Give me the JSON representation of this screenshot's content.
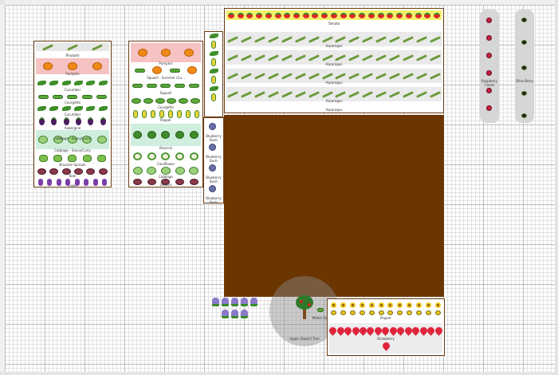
{
  "beds": {
    "bed_a": {
      "labels": [
        "Rhubarb",
        "Pumpkin",
        "Cucumber",
        "Courgette",
        "Cucumber",
        "Aubergine",
        "Cabbage - Savoy/Curly",
        "Cabbage - Savoy/Curly",
        "Brussels Sprouts",
        "Kale",
        "Leek"
      ]
    },
    "bed_b": {
      "labels": [
        "Pumpkin",
        "Squash - Summer (Cu...",
        "Squash",
        "Courgette",
        "Pepper",
        "Broccoli",
        "Cauliflower",
        "Cabbage",
        "Lettuce"
      ]
    },
    "bed_c": {
      "labels": [
        "Tomato",
        "Asparagus",
        "Asparagus",
        "Asparagus",
        "Asparagus",
        "Asparagus"
      ]
    },
    "bed_d": {
      "labels": [
        "Blueberry Bush",
        "Blueberry Bush",
        "Blueberry Bush",
        "Blueberry Bush"
      ]
    },
    "bed_e": {
      "labels": [
        "Raspberry Canes"
      ]
    },
    "bed_f": {
      "labels": [
        "Olive Berry"
      ]
    },
    "bed_g": {
      "labels": [
        "Pepper",
        "Strawberry"
      ]
    },
    "tree": {
      "label": "Apple (Dwarf) Tree",
      "label2": "Melon (Squash)"
    }
  },
  "colors": {
    "soil": "#6b3500",
    "border": "#6b3d13",
    "grid_major": "#bcbcbc",
    "grid_minor": "#e2e2e2"
  }
}
